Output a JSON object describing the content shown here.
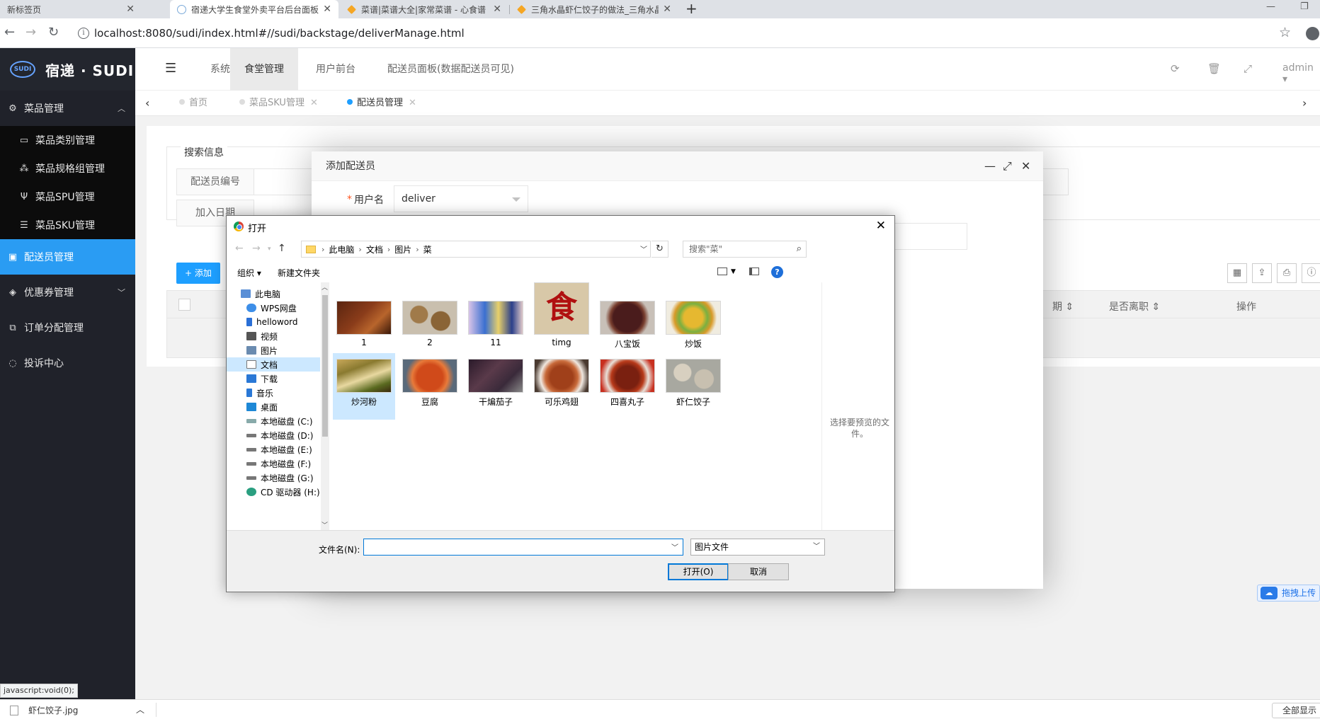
{
  "browser": {
    "tabs": [
      {
        "label": "新标签页"
      },
      {
        "label": "宿递大学生食堂外卖平台后台面板"
      },
      {
        "label": "菜谱|菜谱大全|家常菜谱 - 心食谱"
      },
      {
        "label": "三角水晶虾仁饺子的做法_三角水晶"
      }
    ],
    "url": "localhost:8080/sudi/index.html#//sudi/backstage/deliverManage.html",
    "status_url": "javascript:void(0);",
    "download_file": "虾仁饺子.jpg",
    "download_show_all": "全部显示"
  },
  "app": {
    "logo_badge": "SUDI",
    "logo_text": "宿递 · SUDI",
    "sidebar": [
      {
        "label": "菜品管理",
        "icon": "gears-icon"
      },
      {
        "label": "菜品类别管理",
        "icon": "inbox-icon"
      },
      {
        "label": "菜品规格组管理",
        "icon": "sitemap-icon"
      },
      {
        "label": "菜品SPU管理",
        "icon": "utensils-icon"
      },
      {
        "label": "菜品SKU管理",
        "icon": "list-icon"
      },
      {
        "label": "配送员管理",
        "icon": "bag-icon"
      },
      {
        "label": "优惠券管理",
        "icon": "tag-icon"
      },
      {
        "label": "订单分配管理",
        "icon": "copy-icon"
      },
      {
        "label": "投诉中心",
        "icon": "comment-icon"
      }
    ],
    "header_menu": [
      "系统管理",
      "食堂管理",
      "用户前台",
      "配送员面板(数据配送员可见)"
    ],
    "admin": "admin",
    "page_tabs": [
      "首页",
      "菜品SKU管理",
      "配送员管理"
    ],
    "search_legend": "搜索信息",
    "search_fields": [
      "配送员编号",
      "加入日期"
    ],
    "add_button": "添加",
    "table_headers": [
      "期",
      "是否离职",
      "操作"
    ],
    "upload_button": "拖拽上传"
  },
  "modal": {
    "title": "添加配送员",
    "username_label": "用户名",
    "username_value": "deliver"
  },
  "dialog": {
    "title": "打开",
    "breadcrumb": [
      "此电脑",
      "文档",
      "图片",
      "菜"
    ],
    "search_placeholder": "搜索\"菜\"",
    "organize": "组织",
    "new_folder": "新建文件夹",
    "tree": [
      "此电脑",
      "WPS网盘",
      "helloword",
      "视频",
      "图片",
      "文档",
      "下载",
      "音乐",
      "桌面",
      "本地磁盘 (C:)",
      "本地磁盘 (D:)",
      "本地磁盘 (E:)",
      "本地磁盘 (F:)",
      "本地磁盘 (G:)",
      "CD 驱动器 (H:)"
    ],
    "files": [
      "1",
      "2",
      "11",
      "timg",
      "八宝饭",
      "炒饭",
      "炒河粉",
      "豆腐",
      "干煸茄子",
      "可乐鸡翅",
      "四喜丸子",
      "虾仁饺子"
    ],
    "preview_hint": "选择要预览的文件。",
    "filename_label": "文件名(N):",
    "filename_value": "",
    "filetype": "图片文件",
    "open_button": "打开(O)",
    "cancel_button": "取消"
  },
  "colors": {
    "sidebar_bg": "#20222a",
    "sidebar_active": "#2a9cf3",
    "primary": "#1e9fff",
    "dialog_select": "#cce8ff"
  }
}
